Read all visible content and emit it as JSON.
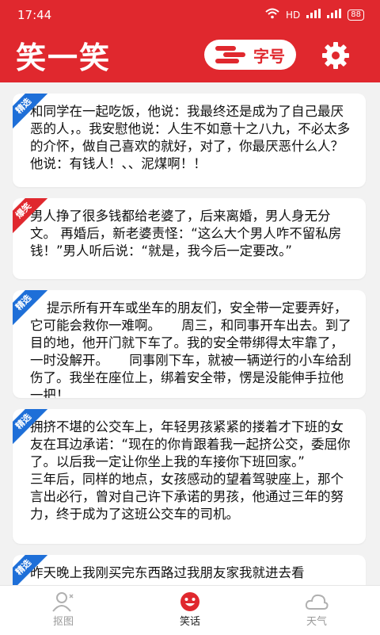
{
  "status": {
    "time": "17:44",
    "network": "HD",
    "battery": "88"
  },
  "header": {
    "title": "笑一笑",
    "font_button": "字号"
  },
  "cards": [
    {
      "tag": "精选",
      "text": "和同学在一起吃饭，他说：我最终还是成为了自己最厌恶的人，。我安慰他说：人生不如意十之八九，不必太多的介怀，做自己喜欢的就好，对了，你最厌恶什么人？他说：有钱人！、、泥煤啊！！"
    },
    {
      "tag": "爆笑",
      "text": "男人挣了很多钱都给老婆了，后来离婚，男人身无分文。 再婚后，新老婆责怪：“这么大个男人咋不留私房钱！”男人听后说：“就是，我今后一定要改。”"
    },
    {
      "tag": "精选",
      "text": "    提示所有开车或坐车的朋友们，安全带一定要弄好，它可能会救你一难啊。     周三，和同事开车出去。到了目的地，他开门就下车了。我的安全带绑得太牢靠了，一时没解开。     同事刚下车，就被一辆逆行的小车给刮伤了。我坐在座位上，绑着安全带，愣是没能伸手拉他一把！"
    },
    {
      "tag": "精选",
      "text": "拥挤不堪的公交车上，年轻男孩紧紧的搂着才下班的女友在耳边承诺：“现在的你肯跟着我一起挤公交，委屈你了。以后我一定让你坐上我的车接你下班回家。”\n三年后，同样的地点，女孩感动的望着驾驶座上，那个言出必行，曾对自己许下承诺的男孩，他通过三年的努力，终于成为了这班公交车的司机。"
    },
    {
      "tag": "精选",
      "text": "昨天晚上我刚买完东西路过我朋友家我就进去看"
    }
  ],
  "tabs": [
    {
      "label": "抠图",
      "icon": "person-icon"
    },
    {
      "label": "笑话",
      "icon": "smile-icon"
    },
    {
      "label": "天气",
      "icon": "cloud-icon"
    }
  ],
  "colors": {
    "brand": "#e0282e",
    "ribbon_blue": "#1e6fd8"
  }
}
